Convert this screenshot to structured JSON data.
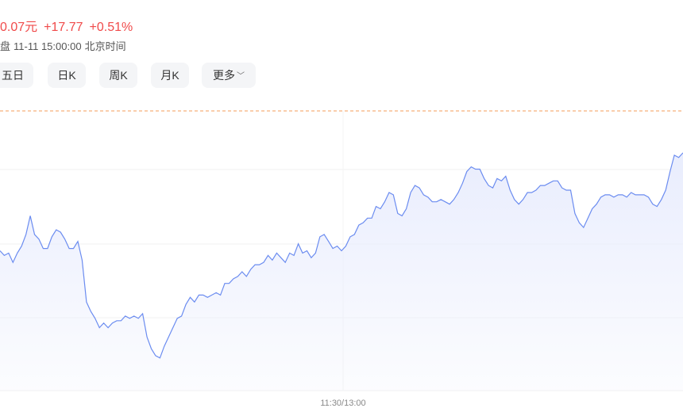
{
  "quote": {
    "price_text": "0.07元",
    "change": "+17.77",
    "change_pct": "+0.51%",
    "status": "盘",
    "datetime": "11-11 15:00:00",
    "timezone": "北京时间",
    "up_color": "#f04a4a"
  },
  "tabs": [
    {
      "label": "五日"
    },
    {
      "label": "日K"
    },
    {
      "label": "周K"
    },
    {
      "label": "月K"
    },
    {
      "label": "更多",
      "icon": "chevron-down-icon"
    }
  ],
  "chart_data": {
    "type": "area",
    "line_color": "#6b8cf0",
    "fill_color": "#e9edfd",
    "reference_line_color": "#f39c5a",
    "grid": true,
    "x_tick_labels": [
      "11:30/13:00"
    ],
    "y": [
      0.5,
      0.4833,
      0.4917,
      0.4583,
      0.4917,
      0.5167,
      0.5583,
      0.625,
      0.5583,
      0.5417,
      0.5083,
      0.5083,
      0.55,
      0.575,
      0.5667,
      0.5417,
      0.5083,
      0.5083,
      0.5333,
      0.4667,
      0.3167,
      0.2833,
      0.2583,
      0.225,
      0.2417,
      0.225,
      0.2417,
      0.25,
      0.25,
      0.2667,
      0.2583,
      0.2667,
      0.2583,
      0.275,
      0.1917,
      0.15,
      0.125,
      0.1167,
      0.1583,
      0.1917,
      0.225,
      0.2583,
      0.2667,
      0.3083,
      0.3333,
      0.3167,
      0.3417,
      0.3417,
      0.3333,
      0.3417,
      0.35,
      0.3417,
      0.3833,
      0.3833,
      0.4,
      0.4083,
      0.425,
      0.4083,
      0.4333,
      0.45,
      0.45,
      0.4583,
      0.4833,
      0.4667,
      0.4917,
      0.475,
      0.4583,
      0.4917,
      0.4833,
      0.525,
      0.4917,
      0.5,
      0.475,
      0.4917,
      0.55,
      0.5583,
      0.5333,
      0.5083,
      0.5167,
      0.5,
      0.5167,
      0.55,
      0.5583,
      0.5917,
      0.6,
      0.6167,
      0.6167,
      0.6583,
      0.65,
      0.675,
      0.7083,
      0.7,
      0.6333,
      0.625,
      0.65,
      0.7083,
      0.7333,
      0.725,
      0.7,
      0.6917,
      0.675,
      0.675,
      0.6833,
      0.675,
      0.6667,
      0.6833,
      0.7083,
      0.7417,
      0.7833,
      0.8,
      0.7917,
      0.7917,
      0.7583,
      0.7333,
      0.725,
      0.7583,
      0.75,
      0.7667,
      0.7167,
      0.6833,
      0.6667,
      0.6833,
      0.7083,
      0.7083,
      0.7167,
      0.7333,
      0.7333,
      0.7417,
      0.75,
      0.75,
      0.725,
      0.7167,
      0.7167,
      0.6333,
      0.6,
      0.5833,
      0.6167,
      0.65,
      0.6667,
      0.6917,
      0.7,
      0.7,
      0.6917,
      0.7,
      0.7,
      0.6917,
      0.7083,
      0.7,
      0.7,
      0.7,
      0.6917,
      0.6667,
      0.6583,
      0.6833,
      0.7167,
      0.7833,
      0.8417,
      0.8333,
      0.85
    ]
  }
}
